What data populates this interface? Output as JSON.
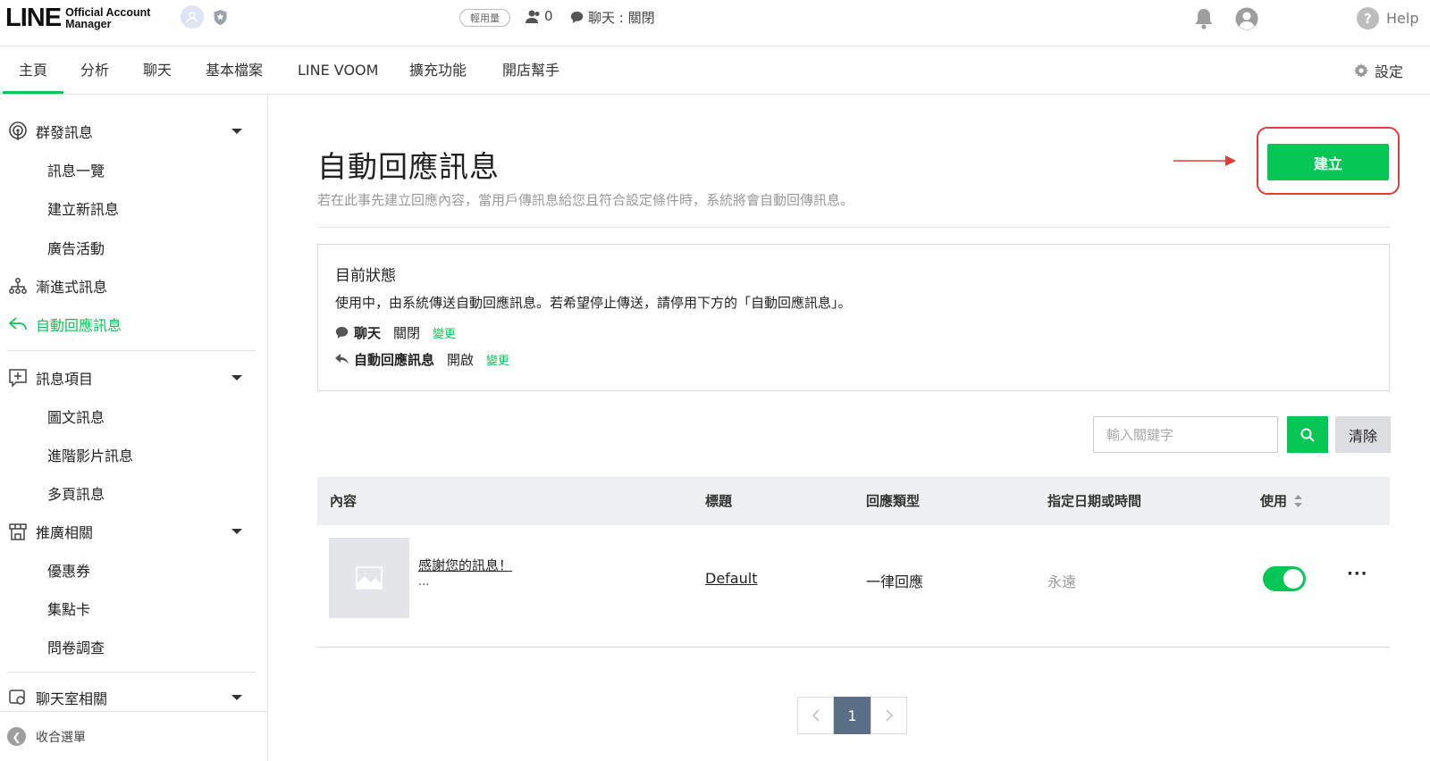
{
  "header": {
    "logo_main": "LINE",
    "logo_sub_1": "Official Account",
    "logo_sub_2": "Manager",
    "plan_badge": "輕用量",
    "friend_count": "0",
    "chat_status": "聊天 : 關閉",
    "help_label": "Help"
  },
  "nav": {
    "tabs": [
      "主頁",
      "分析",
      "聊天",
      "基本檔案",
      "LINE VOOM",
      "擴充功能",
      "開店幫手"
    ],
    "active_tab": "主頁",
    "settings_label": "設定"
  },
  "sidebar": {
    "broadcast": "群發訊息",
    "broadcast_list": "訊息一覽",
    "broadcast_new": "建立新訊息",
    "ad_campaign": "廣告活動",
    "step_message": "漸進式訊息",
    "auto_reply": "自動回應訊息",
    "message_items": "訊息項目",
    "rich_message": "圖文訊息",
    "rich_video": "進階影片訊息",
    "card_message": "多頁訊息",
    "promotion": "推廣相關",
    "coupon": "優惠券",
    "reward_card": "集點卡",
    "survey": "問卷調查",
    "chat_related": "聊天室相關",
    "collapse": "收合選單"
  },
  "main": {
    "title": "自動回應訊息",
    "description": "若在此事先建立回應內容，當用戶傳訊息給您且符合設定條件時，系統將會自動回傳訊息。",
    "create_button": "建立",
    "status": {
      "title": "目前狀態",
      "message": "使用中，由系統傳送自動回應訊息。若希望停止傳送，請停用下方的「自動回應訊息」。",
      "chat_label": "聊天",
      "chat_value": "關閉",
      "auto_label": "自動回應訊息",
      "auto_value": "開啟",
      "change_label": "變更"
    },
    "search": {
      "placeholder": "輸入關鍵字",
      "clear": "清除"
    },
    "table": {
      "headers": {
        "content": "內容",
        "title": "標題",
        "type": "回應類型",
        "schedule": "指定日期或時間",
        "enabled": "使用"
      },
      "rows": [
        {
          "message": "感謝您的訊息！",
          "message_more": "...",
          "title": "Default",
          "type": "一律回應",
          "schedule": "永遠",
          "enabled": true
        }
      ]
    },
    "pagination": {
      "current": "1"
    }
  },
  "colors": {
    "brand_green": "#06c755",
    "highlight_red": "#e53935",
    "page_active": "#5a6e86"
  }
}
